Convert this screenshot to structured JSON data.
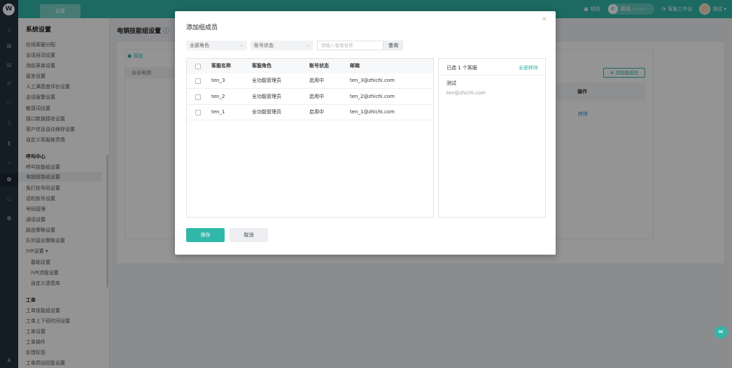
{
  "topbar": {
    "tab_label": "设置",
    "sms_label": "短信",
    "status_label": "离线 --:--:--",
    "workbench_label": "客服工作台",
    "user_label": "测试 ▾"
  },
  "sidebar": {
    "title": "系统设置",
    "section1": [
      "在线客服分配",
      "会话自动设置",
      "询前表单设置",
      "留言设置",
      "人工满意度评价设置",
      "会话报警设置",
      "敏感词设置",
      "接口数据接收设置",
      "客户信息自动保存设置",
      "自定义客服拨责情"
    ],
    "call_center": {
      "head": "呼叫中心",
      "items": [
        "呼叫技能组设置",
        "电销技能组设置",
        "免打扰号码设置",
        "话机账号设置",
        "号码管理",
        "通话设置",
        "路由策略设置",
        "队列溢出策略设置",
        "IVR设置 ▾"
      ],
      "ivr_sub": [
        "基础设置",
        "IVR流程设置",
        "自定义语音库"
      ]
    },
    "ticket": {
      "head": "工单",
      "items": [
        "工单技能组设置",
        "工单上下班时间设置",
        "工单设置",
        "工单插件",
        "反馈标签",
        "工单预设回复设置"
      ]
    }
  },
  "main": {
    "title": "电销技能组设置",
    "add_label": "添加",
    "group_cell": "谷谷电销",
    "add_member_label": "添加组成员",
    "op_header": "操作",
    "remove_label": "移除"
  },
  "dialog": {
    "title": "添加组成员",
    "close": "×",
    "role_select": "全部角色",
    "status_select": "账号状态",
    "search_placeholder": "请输入客服名称",
    "query_label": "查询",
    "columns": {
      "name": "客服名称",
      "role": "客服角色",
      "status": "账号状态",
      "email": "邮箱"
    },
    "rows": [
      {
        "name": "ten_3",
        "role": "全功能管理员",
        "status": "启用中",
        "email": "ten_3@zhichi.com"
      },
      {
        "name": "ten_2",
        "role": "全功能管理员",
        "status": "启用中",
        "email": "ten_2@zhichi.com"
      },
      {
        "name": "ten_1",
        "role": "全功能管理员",
        "status": "启用中",
        "email": "ten_1@zhichi.com"
      }
    ],
    "selected": {
      "count_label": "已选 1 个客服",
      "clear_label": "全部移除",
      "name": "测试",
      "email": "ten@zhichi.com"
    },
    "save_label": "保存",
    "cancel_label": "取消"
  },
  "colors": {
    "accent": "#31b7a9",
    "rail": "#23313e",
    "link": "#3a8ee6"
  }
}
